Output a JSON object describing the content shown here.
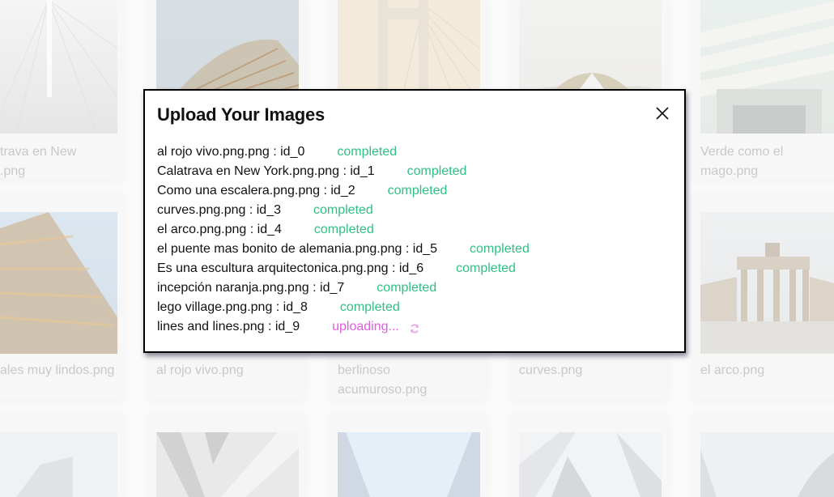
{
  "gallery": {
    "row1": [
      {
        "caption_line1": "trava en New",
        "caption_line2": ".png",
        "palette": [
          "#f3f3f3",
          "#e9e9e9"
        ]
      },
      {
        "caption_line1": "",
        "caption_line2": "",
        "palette": [
          "#d5dde2",
          "#c8a37a"
        ]
      },
      {
        "caption_line1": "",
        "caption_line2": "",
        "palette": [
          "#f4e9da",
          "#e8dccb"
        ]
      },
      {
        "caption_line1": "",
        "caption_line2": "",
        "palette": [
          "#f0f0ee",
          "#5a5a55"
        ]
      },
      {
        "caption_line1": "Verde como el",
        "caption_line2": "mago.png",
        "palette": [
          "#edf1ee",
          "#dfe5df"
        ]
      }
    ],
    "row2": [
      {
        "caption_line1": "ales muy lindos.png",
        "caption_line2": "",
        "palette": [
          "#dbe6f0",
          "#c9a67c"
        ]
      },
      {
        "caption_line1": "al rojo vivo.png",
        "caption_line2": "",
        "palette": [
          "#e8e8e8",
          "#dddddd"
        ]
      },
      {
        "caption_line1": "berlinoso",
        "caption_line2": "acumuroso.png",
        "palette": [
          "#e8e8e8",
          "#dddddd"
        ]
      },
      {
        "caption_line1": "curves.png",
        "caption_line2": "",
        "palette": [
          "#e8e8e8",
          "#dddddd"
        ]
      },
      {
        "caption_line1": "el arco.png",
        "caption_line2": "",
        "palette": [
          "#eef0f0",
          "#c9bfb4"
        ]
      }
    ],
    "row3": [
      {
        "palette": [
          "#eef2f5",
          "#e2e6ea"
        ]
      },
      {
        "palette": [
          "#e6e6e6",
          "#cfcfcf"
        ]
      },
      {
        "palette": [
          "#e4eef6",
          "#c9d4e2"
        ]
      },
      {
        "palette": [
          "#f2f3f5",
          "#dadde1"
        ]
      },
      {
        "palette": [
          "#eef1f3",
          "#d8dcdf"
        ]
      }
    ]
  },
  "modal": {
    "title": "Upload Your Images",
    "close_icon": "close-icon",
    "items": [
      {
        "filename": "al rojo vivo.png.png : id_0",
        "status": "completed"
      },
      {
        "filename": "Calatrava en New York.png.png : id_1",
        "status": "completed"
      },
      {
        "filename": "Como una escalera.png.png : id_2",
        "status": "completed"
      },
      {
        "filename": "curves.png.png : id_3",
        "status": "completed"
      },
      {
        "filename": "el arco.png.png : id_4",
        "status": "completed"
      },
      {
        "filename": "el puente mas bonito de alemania.png.png : id_5",
        "status": "completed"
      },
      {
        "filename": "Es una escultura arquitectonica.png.png : id_6",
        "status": "completed"
      },
      {
        "filename": "incepción naranja.png.png : id_7",
        "status": "completed"
      },
      {
        "filename": "lego village.png.png : id_8",
        "status": "completed"
      },
      {
        "filename": "lines and lines.png : id_9",
        "status": "uploading...",
        "icon": "refresh-spinner-icon"
      }
    ],
    "colors": {
      "completed": "#2fbf86",
      "uploading": "#e05ce0"
    }
  }
}
